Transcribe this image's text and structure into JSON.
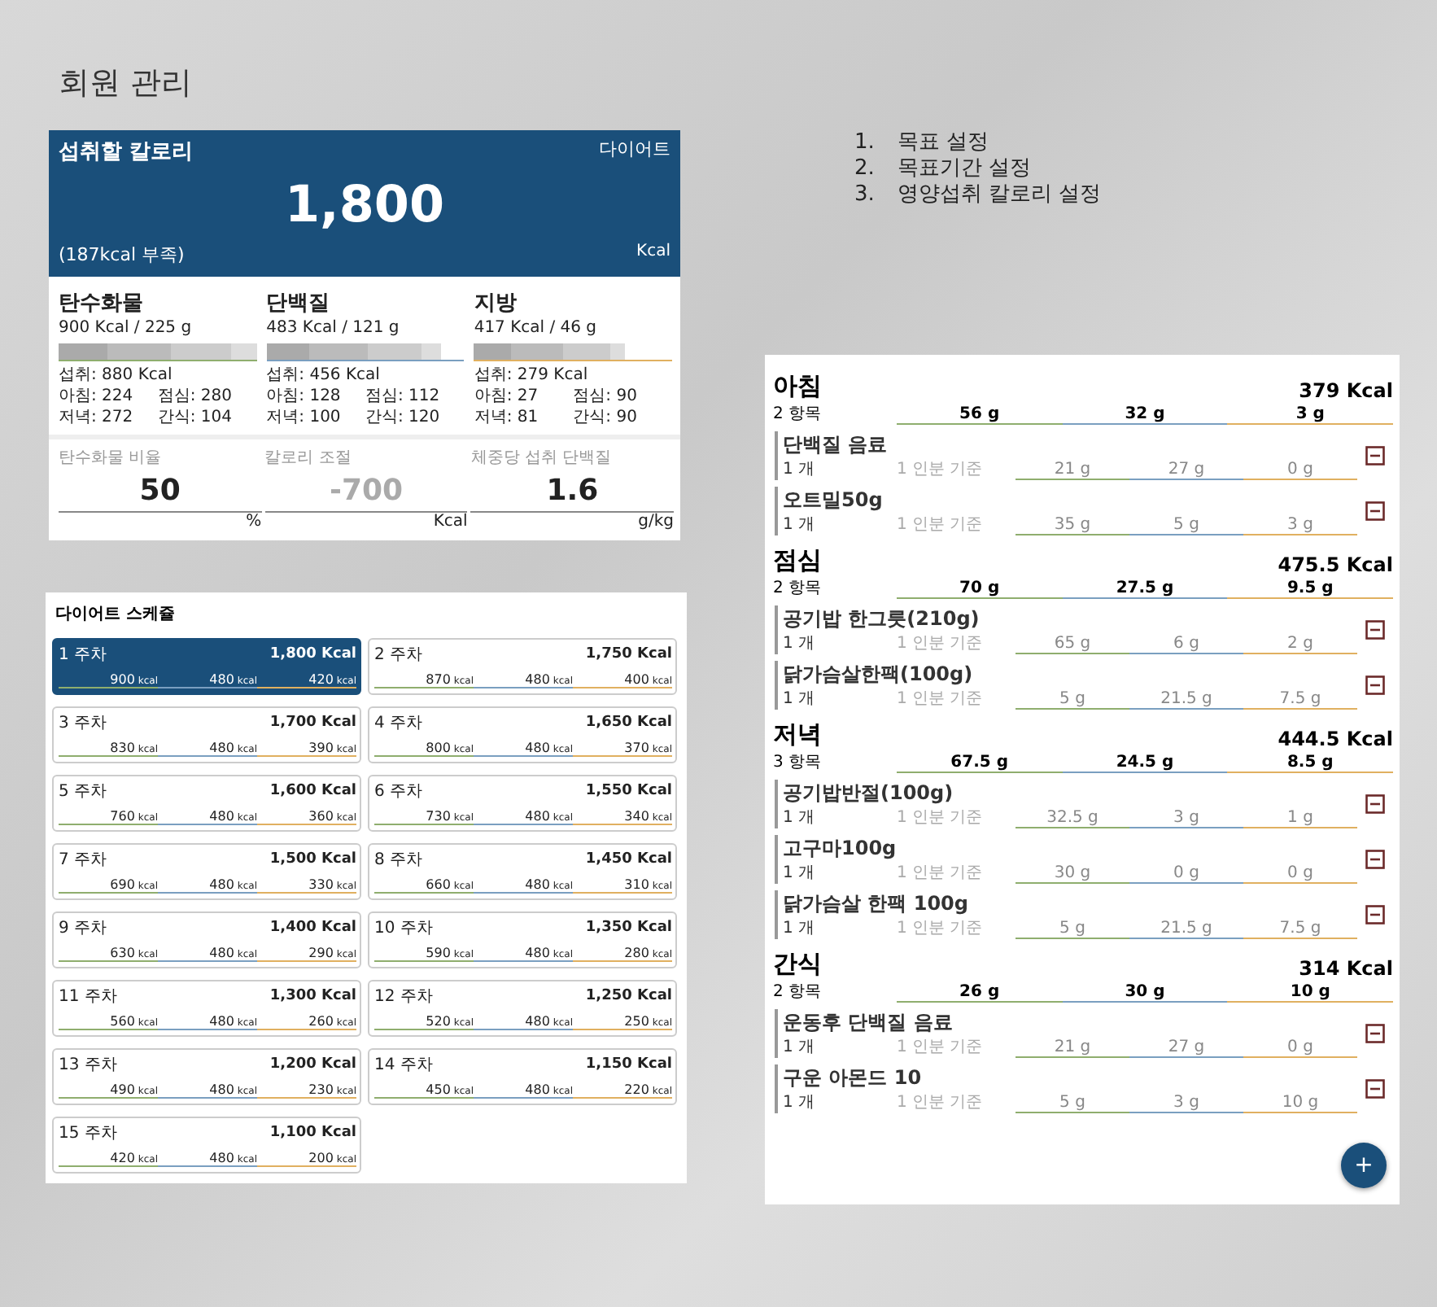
{
  "title": "회원 관리",
  "steps": [
    {
      "number": "1.",
      "text": "목표 설정"
    },
    {
      "number": "2.",
      "text": "목표기간 설정"
    },
    {
      "number": "3.",
      "text": "영양섭취 칼로리 설정"
    }
  ],
  "calorie_card": {
    "title": "섭취할 칼로리",
    "mode": "다이어트",
    "value": "1,800",
    "deficit": "(187kcal 부족)",
    "unit": "Kcal"
  },
  "macros": [
    {
      "name": "탄수화물",
      "target": "900 Kcal / 225 g",
      "color": "#8fae6e",
      "intake": "섭취: 880 Kcal",
      "meals": [
        "아침: 224",
        "점심: 280",
        "저녁: 272",
        "간식: 104"
      ]
    },
    {
      "name": "단백질",
      "target": "483 Kcal / 121 g",
      "color": "#7a9fc0",
      "intake": "섭취: 456 Kcal",
      "meals": [
        "아침: 128",
        "점심: 112",
        "저녁: 100",
        "간식: 120"
      ]
    },
    {
      "name": "지방",
      "target": "417 Kcal / 46 g",
      "color": "#e0b060",
      "intake": "섭취: 279 Kcal",
      "meals": [
        "아침: 27",
        "점심: 90",
        "저녁: 81",
        "간식: 90"
      ]
    }
  ],
  "settings": [
    {
      "label": "탄수화물 비율",
      "value": "50",
      "unit": "%",
      "disabled": false
    },
    {
      "label": "칼로리 조절",
      "value": "-700",
      "unit": "Kcal",
      "disabled": true
    },
    {
      "label": "체중당 섭취 단백질",
      "value": "1.6",
      "unit": "g/kg",
      "disabled": false
    }
  ],
  "schedule": {
    "title": "다이어트 스케쥴",
    "weeks": [
      {
        "label": "1 주차",
        "total": "1,800 Kcal",
        "carb": "900 kcal",
        "protein": "480 kcal",
        "fat": "420 kcal",
        "selected": true
      },
      {
        "label": "2 주차",
        "total": "1,750 Kcal",
        "carb": "870 kcal",
        "protein": "480 kcal",
        "fat": "400 kcal",
        "selected": false
      },
      {
        "label": "3 주차",
        "total": "1,700 Kcal",
        "carb": "830 kcal",
        "protein": "480 kcal",
        "fat": "390 kcal",
        "selected": false
      },
      {
        "label": "4 주차",
        "total": "1,650 Kcal",
        "carb": "800 kcal",
        "protein": "480 kcal",
        "fat": "370 kcal",
        "selected": false
      },
      {
        "label": "5 주차",
        "total": "1,600 Kcal",
        "carb": "760 kcal",
        "protein": "480 kcal",
        "fat": "360 kcal",
        "selected": false
      },
      {
        "label": "6 주차",
        "total": "1,550 Kcal",
        "carb": "730 kcal",
        "protein": "480 kcal",
        "fat": "340 kcal",
        "selected": false
      },
      {
        "label": "7 주차",
        "total": "1,500 Kcal",
        "carb": "690 kcal",
        "protein": "480 kcal",
        "fat": "330 kcal",
        "selected": false
      },
      {
        "label": "8 주차",
        "total": "1,450 Kcal",
        "carb": "660 kcal",
        "protein": "480 kcal",
        "fat": "310 kcal",
        "selected": false
      },
      {
        "label": "9 주차",
        "total": "1,400 Kcal",
        "carb": "630 kcal",
        "protein": "480 kcal",
        "fat": "290 kcal",
        "selected": false
      },
      {
        "label": "10 주차",
        "total": "1,350 Kcal",
        "carb": "590 kcal",
        "protein": "480 kcal",
        "fat": "280 kcal",
        "selected": false
      },
      {
        "label": "11 주차",
        "total": "1,300 Kcal",
        "carb": "560 kcal",
        "protein": "480 kcal",
        "fat": "260 kcal",
        "selected": false
      },
      {
        "label": "12 주차",
        "total": "1,250 Kcal",
        "carb": "520 kcal",
        "protein": "480 kcal",
        "fat": "250 kcal",
        "selected": false
      },
      {
        "label": "13 주차",
        "total": "1,200 Kcal",
        "carb": "490 kcal",
        "protein": "480 kcal",
        "fat": "230 kcal",
        "selected": false
      },
      {
        "label": "14 주차",
        "total": "1,150 Kcal",
        "carb": "450 kcal",
        "protein": "480 kcal",
        "fat": "220 kcal",
        "selected": false
      },
      {
        "label": "15 주차",
        "total": "1,100 Kcal",
        "carb": "420 kcal",
        "protein": "480 kcal",
        "fat": "200 kcal",
        "selected": false
      }
    ]
  },
  "meals": [
    {
      "name": "아침",
      "kcal": "379 Kcal",
      "count": "2 항목",
      "carb": "56 g",
      "protein": "32 g",
      "fat": "3 g",
      "items": [
        {
          "name": "단백질 음료",
          "qty": "1 개",
          "basis": "1 인분 기준",
          "carb": "21 g",
          "protein": "27 g",
          "fat": "0 g"
        },
        {
          "name": "오트밀50g",
          "qty": "1 개",
          "basis": "1 인분 기준",
          "carb": "35 g",
          "protein": "5 g",
          "fat": "3 g"
        }
      ]
    },
    {
      "name": "점심",
      "kcal": "475.5 Kcal",
      "count": "2 항목",
      "carb": "70 g",
      "protein": "27.5 g",
      "fat": "9.5 g",
      "items": [
        {
          "name": "공기밥 한그릇(210g)",
          "qty": "1 개",
          "basis": "1 인분 기준",
          "carb": "65 g",
          "protein": "6 g",
          "fat": "2 g"
        },
        {
          "name": "닭가슴살한팩(100g)",
          "qty": "1 개",
          "basis": "1 인분 기준",
          "carb": "5 g",
          "protein": "21.5 g",
          "fat": "7.5 g"
        }
      ]
    },
    {
      "name": "저녁",
      "kcal": "444.5 Kcal",
      "count": "3 항목",
      "carb": "67.5 g",
      "protein": "24.5 g",
      "fat": "8.5 g",
      "items": [
        {
          "name": "공기밥반절(100g)",
          "qty": "1 개",
          "basis": "1 인분 기준",
          "carb": "32.5 g",
          "protein": "3 g",
          "fat": "1 g"
        },
        {
          "name": "고구마100g",
          "qty": "1 개",
          "basis": "1 인분 기준",
          "carb": "30 g",
          "protein": "0 g",
          "fat": "0 g"
        },
        {
          "name": "닭가슴살 한팩 100g",
          "qty": "1 개",
          "basis": "1 인분 기준",
          "carb": "5 g",
          "protein": "21.5 g",
          "fat": "7.5 g"
        }
      ]
    },
    {
      "name": "간식",
      "kcal": "314 Kcal",
      "count": "2 항목",
      "carb": "26 g",
      "protein": "30 g",
      "fat": "10 g",
      "items": [
        {
          "name": "운동후 단백질 음료",
          "qty": "1 개",
          "basis": "1 인분 기준",
          "carb": "21 g",
          "protein": "27 g",
          "fat": "0 g"
        },
        {
          "name": "구운 아몬드 10",
          "qty": "1 개",
          "basis": "1 인분 기준",
          "carb": "5 g",
          "protein": "3 g",
          "fat": "10 g"
        }
      ]
    }
  ],
  "fab": "+"
}
